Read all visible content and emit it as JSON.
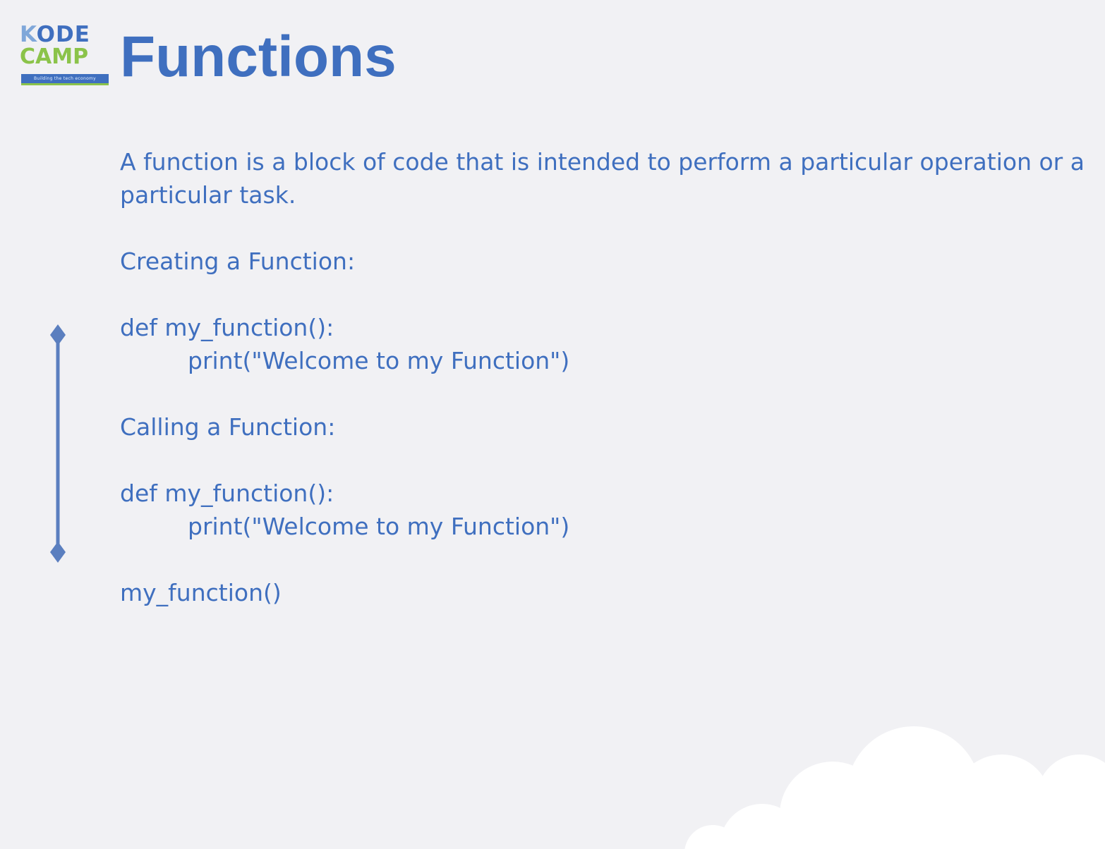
{
  "logo": {
    "line1_k": "K",
    "line1_rest": "ODE",
    "line2": "CAMP",
    "tagline": "Building the tech economy"
  },
  "title": "Functions",
  "content": {
    "intro": "A function is a block of code that is intended to perform a particular operation or a particular task.",
    "creating_heading": "Creating a Function:",
    "creating_code_line1": "def my_function():",
    "creating_code_line2": "print(\"Welcome to my Function\")",
    "calling_heading": "Calling a Function:",
    "calling_code_line1": "def my_function():",
    "calling_code_line2": "print(\"Welcome to my Function\")",
    "call_line": "my_function()"
  },
  "colors": {
    "text_blue": "#3f6fbf",
    "logo_green": "#8bc34a",
    "background": "#f1f1f4",
    "timeline": "#5b7fbf"
  },
  "icons": [
    "kodecamp-logo",
    "timeline-icon",
    "cloud-decoration"
  ]
}
